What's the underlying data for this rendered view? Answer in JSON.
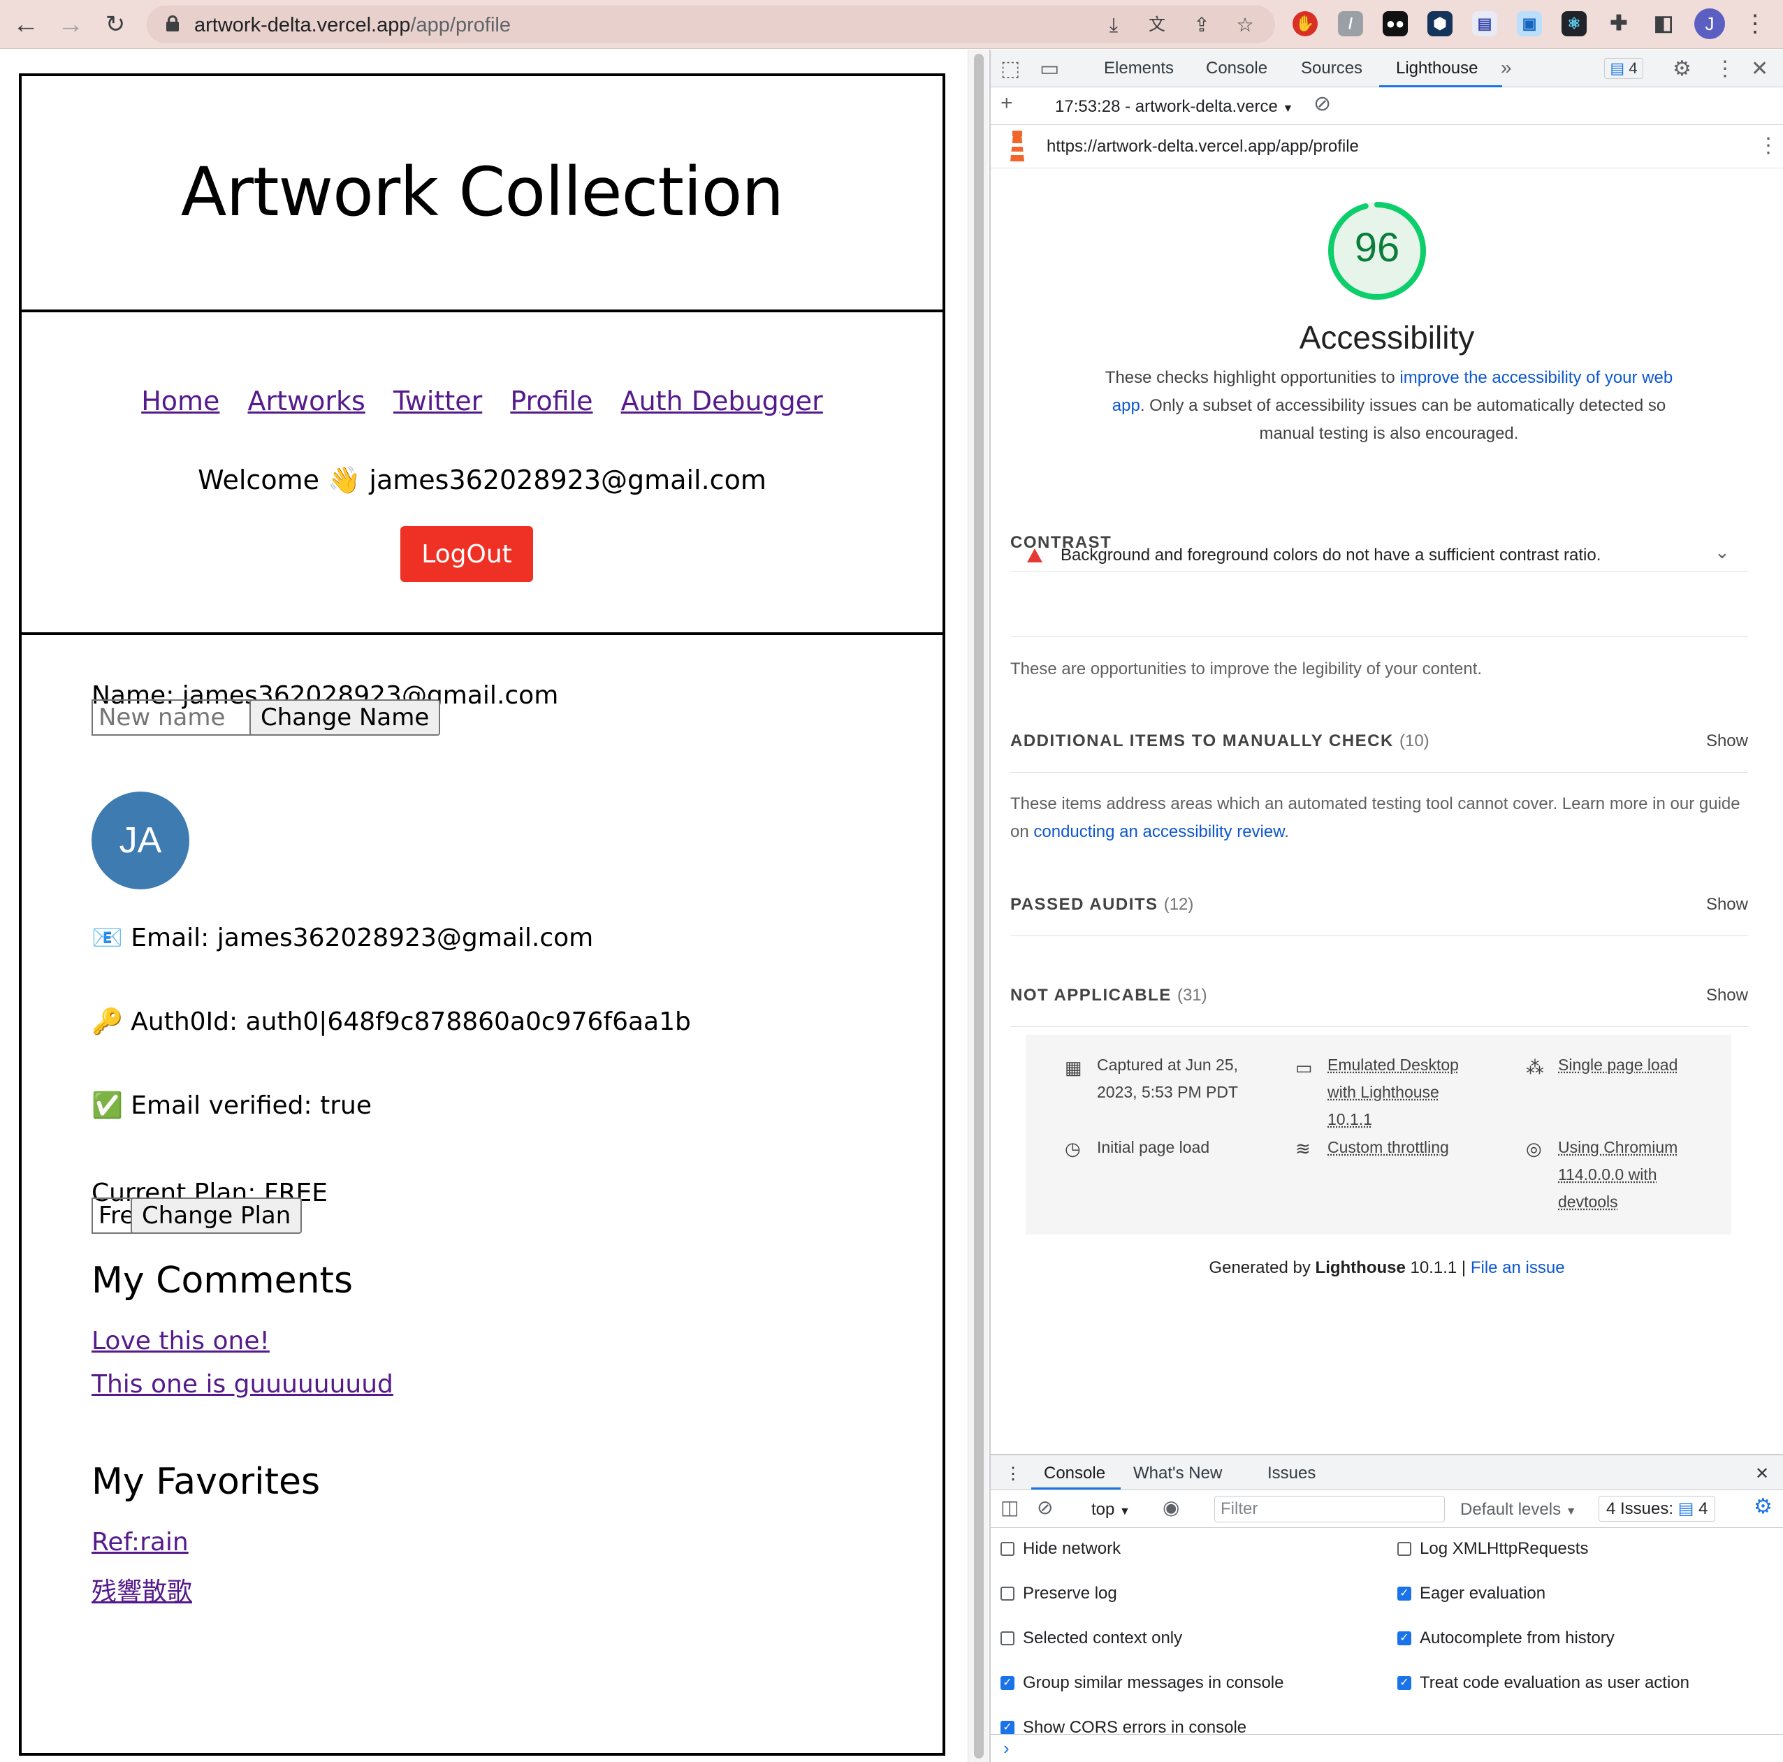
{
  "browser": {
    "url_host": "artwork-delta.vercel.app",
    "url_path": "/app/profile",
    "profile_initial": "J"
  },
  "page": {
    "title": "Artwork Collection",
    "nav": [
      "Home",
      "Artworks",
      "Twitter",
      "Profile",
      "Auth Debugger"
    ],
    "welcome": "Welcome 👋 james362028923@gmail.com",
    "logout_label": "LogOut",
    "name_line": "Name: james362028923@gmail.com",
    "new_name_placeholder": "New name",
    "change_name_label": "Change Name",
    "avatar_initials": "JA",
    "email_line": "📧 Email: james362028923@gmail.com",
    "auth_line": "🔑 Auth0Id: auth0|648f9c878860a0c976f6aa1b",
    "verified_line": "✅ Email verified: true",
    "plan_line": "Current Plan: FREE",
    "plan_selected": "Free",
    "change_plan_label": "Change Plan",
    "comments_heading": "My Comments",
    "comments": [
      "Love this one!",
      "This one is guuuuuuuud"
    ],
    "favorites_heading": "My Favorites",
    "favorites": [
      "Ref:rain",
      "残響散歌"
    ]
  },
  "devtools": {
    "tabs": [
      "Elements",
      "Console",
      "Sources",
      "Lighthouse"
    ],
    "active_tab": "Lighthouse",
    "issues_count": "4",
    "report_label": "17:53:28 - artwork-delta.verce",
    "report_url": "https://artwork-delta.vercel.app/app/profile",
    "score": "96",
    "score_fraction": 0.96,
    "score_color": "#0cce6b",
    "category": "Accessibility",
    "desc_before": "These checks highlight opportunities to ",
    "desc_link": "improve the accessibility of your web app",
    "desc_after": ". Only a subset of accessibility issues can be automatically detected so manual testing is also encouraged.",
    "contrast_heading": "CONTRAST",
    "contrast_item": "Background and foreground colors do not have a sufficient contrast ratio.",
    "contrast_note": "These are opportunities to improve the legibility of your content.",
    "manual_heading": "ADDITIONAL ITEMS TO MANUALLY CHECK",
    "manual_count": "(10)",
    "manual_note_before": "These items address areas which an automated testing tool cannot cover. Learn more in our guide on ",
    "manual_note_link": "conducting an accessibility review",
    "manual_note_after": ".",
    "passed_heading": "PASSED AUDITS",
    "passed_count": "(12)",
    "na_heading": "NOT APPLICABLE",
    "na_count": "(31)",
    "show_label": "Show",
    "env": {
      "captured": "Captured at Jun 25, 2023, 5:53 PM PDT",
      "emulated": "Emulated Desktop with Lighthouse 10.1.1",
      "single": "Single page load",
      "initial": "Initial page load",
      "throttling": "Custom throttling",
      "chromium": "Using Chromium 114.0.0.0 with devtools"
    },
    "generated_before": "Generated by ",
    "generated_brand": "Lighthouse",
    "generated_version": " 10.1.1 | ",
    "file_issue": "File an issue"
  },
  "drawer": {
    "tabs": [
      "Console",
      "What's New",
      "Issues"
    ],
    "context": "top",
    "filter_placeholder": "Filter",
    "levels": "Default levels",
    "issues_label": "4 Issues:",
    "issues_count": "4",
    "options_left": [
      {
        "label": "Hide network",
        "checked": false
      },
      {
        "label": "Preserve log",
        "checked": false
      },
      {
        "label": "Selected context only",
        "checked": false
      },
      {
        "label": "Group similar messages in console",
        "checked": true
      },
      {
        "label": "Show CORS errors in console",
        "checked": true
      }
    ],
    "options_right": [
      {
        "label": "Log XMLHttpRequests",
        "checked": false
      },
      {
        "label": "Eager evaluation",
        "checked": true
      },
      {
        "label": "Autocomplete from history",
        "checked": true
      },
      {
        "label": "Treat code evaluation as user action",
        "checked": true
      }
    ]
  }
}
